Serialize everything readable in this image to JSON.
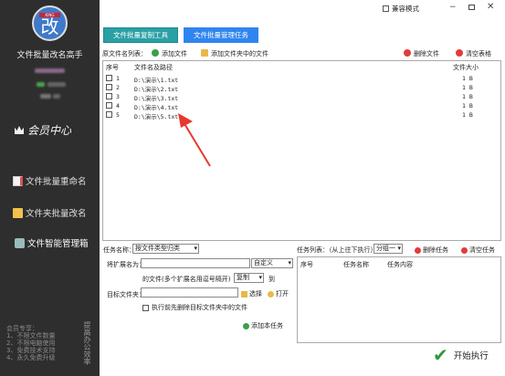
{
  "app": {
    "title": "文件批量改名高手",
    "logo_tag": "KING",
    "logo_glyph": "改",
    "member_center": "会员中心"
  },
  "sidebar": {
    "items": [
      {
        "label": "文件批量重命名"
      },
      {
        "label": "文件夹批量改名"
      },
      {
        "label": "文件智能管理箱"
      }
    ],
    "footer_notes": [
      "会员专享：",
      "1、不限文件数量",
      "2、不限电脑使用",
      "3、免费技术支持",
      "4、永久免费升级"
    ],
    "footer_side": "提高办公效率"
  },
  "window": {
    "compat_mode_label": "兼容模式",
    "minimize": "−",
    "close": "✕"
  },
  "tool_tabs": {
    "copy_tool": "文件批量复制工具",
    "manage_task": "文件批量管理任务"
  },
  "file_toolbar": {
    "list_label": "原文件名列表：",
    "add_file": "添加文件",
    "add_folder_files": "添加文件夹中的文件",
    "delete_file": "删除文件",
    "clear_table": "清空表格"
  },
  "file_table": {
    "headers": {
      "no": "序号",
      "path": "文件名及路径",
      "size": "文件大小"
    },
    "rows": [
      {
        "no": "1",
        "path": "D:\\演示\\1.txt",
        "size": "1 B"
      },
      {
        "no": "2",
        "path": "D:\\演示\\2.txt",
        "size": "1 B"
      },
      {
        "no": "3",
        "path": "D:\\演示\\3.txt",
        "size": "1 B"
      },
      {
        "no": "4",
        "path": "D:\\演示\\4.txt",
        "size": "1 B"
      },
      {
        "no": "5",
        "path": "D:\\演示\\5.txt",
        "size": "1 B"
      }
    ]
  },
  "task_form": {
    "task_name_label": "任务名称：",
    "task_name_value": "按文件类型归类",
    "ext_label": "将扩展名为：",
    "ext_value": "",
    "custom_option": "自定义",
    "ext_hint": "的文件(多个扩展名用逗号隔开)",
    "action_option": "复制",
    "to_label": "到",
    "target_label": "目标文件夹：",
    "target_value": "",
    "choose_label": "选择",
    "open_label": "打开",
    "delete_first_label": "执行前先删除目标文件夹中的文件",
    "add_task_label": "添加本任务"
  },
  "task_list": {
    "label": "任务列表：（从上往下执行）",
    "group_option": "分组一",
    "delete_task": "删除任务",
    "clear_task": "清空任务",
    "headers": {
      "no": "序号",
      "name": "任务名称",
      "content": "任务内容"
    }
  },
  "start_label": "开始执行"
}
